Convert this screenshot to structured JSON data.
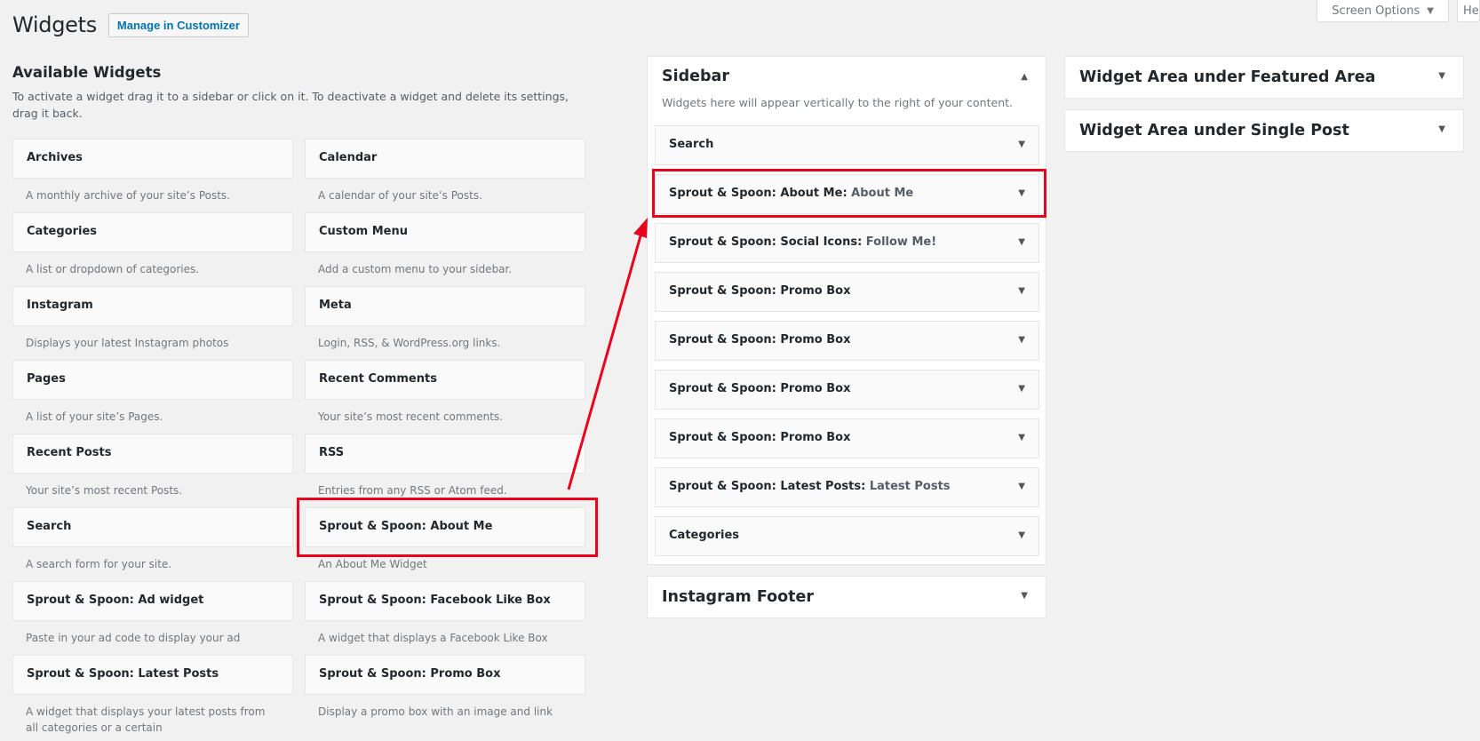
{
  "header": {
    "title": "Widgets",
    "customizer_button": "Manage in Customizer",
    "screen_options": "Screen Options",
    "help": "Help"
  },
  "available": {
    "title": "Available Widgets",
    "description": "To activate a widget drag it to a sidebar or click on it. To deactivate a widget and delete its settings, drag it back.",
    "widgets": [
      {
        "name": "Archives",
        "desc": "A monthly archive of your site’s Posts."
      },
      {
        "name": "Calendar",
        "desc": "A calendar of your site’s Posts."
      },
      {
        "name": "Categories",
        "desc": "A list or dropdown of categories."
      },
      {
        "name": "Custom Menu",
        "desc": "Add a custom menu to your sidebar."
      },
      {
        "name": "Instagram",
        "desc": "Displays your latest Instagram photos"
      },
      {
        "name": "Meta",
        "desc": "Login, RSS, & WordPress.org links."
      },
      {
        "name": "Pages",
        "desc": "A list of your site’s Pages."
      },
      {
        "name": "Recent Comments",
        "desc": "Your site’s most recent comments."
      },
      {
        "name": "Recent Posts",
        "desc": "Your site’s most recent Posts."
      },
      {
        "name": "RSS",
        "desc": "Entries from any RSS or Atom feed."
      },
      {
        "name": "Search",
        "desc": "A search form for your site."
      },
      {
        "name": "Sprout & Spoon: About Me",
        "desc": "An About Me Widget"
      },
      {
        "name": "Sprout & Spoon: Ad widget",
        "desc": "Paste in your ad code to display your ad"
      },
      {
        "name": "Sprout & Spoon: Facebook Like Box",
        "desc": "A widget that displays a Facebook Like Box"
      },
      {
        "name": "Sprout & Spoon: Latest Posts",
        "desc": "A widget that displays your latest posts from all categories or a certain"
      },
      {
        "name": "Sprout & Spoon: Promo Box",
        "desc": "Display a promo box with an image and link"
      }
    ]
  },
  "sidebar": {
    "title": "Sidebar",
    "description": "Widgets here will appear vertically to the right of your content.",
    "items": [
      {
        "name": "Search",
        "subtitle": ""
      },
      {
        "name": "Sprout & Spoon: About Me",
        "subtitle": "About Me"
      },
      {
        "name": "Sprout & Spoon: Social Icons",
        "subtitle": "Follow Me!"
      },
      {
        "name": "Sprout & Spoon: Promo Box",
        "subtitle": ""
      },
      {
        "name": "Sprout & Spoon: Promo Box",
        "subtitle": ""
      },
      {
        "name": "Sprout & Spoon: Promo Box",
        "subtitle": ""
      },
      {
        "name": "Sprout & Spoon: Promo Box",
        "subtitle": ""
      },
      {
        "name": "Sprout & Spoon: Latest Posts",
        "subtitle": "Latest Posts"
      },
      {
        "name": "Categories",
        "subtitle": ""
      }
    ]
  },
  "areas": {
    "instagram_footer": "Instagram Footer",
    "featured_area": "Widget Area under Featured Area",
    "single_post": "Widget Area under Single Post"
  },
  "icons": {
    "caret_down": "caret-down-icon",
    "caret_up": "caret-up-icon"
  },
  "colors": {
    "highlight": "#e8041c",
    "link": "#0073aa",
    "background": "#f1f1f1"
  }
}
